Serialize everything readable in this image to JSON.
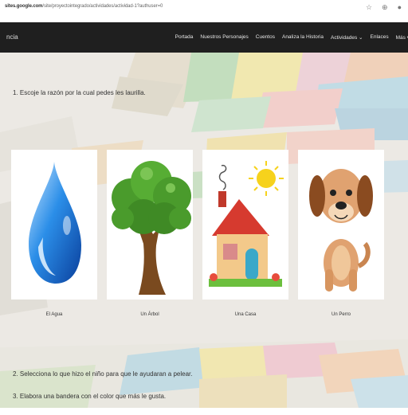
{
  "browser": {
    "url_host": "sites.google.com",
    "url_rest": "/site/proyectointegrado/actividades/actividad-1?authuser=0",
    "icons": [
      "star-icon",
      "extension-icon",
      "profile-icon"
    ]
  },
  "nav": {
    "brand": "ncia",
    "links": [
      "Portada",
      "Nuestros Personajes",
      "Cuentos",
      "Analiza la Historia",
      "Actividades ⌄",
      "Enlaces",
      "Más ▾"
    ]
  },
  "questions": {
    "q1": "1. Escoje la razón por la cual pedes les laurilla.",
    "q2": "2. Selecciona lo que hizo el niño para que le ayudaran a pelear.",
    "q3": "3. Elabora una bandera con el color que más le gusta."
  },
  "cards": [
    {
      "caption": "El Agua",
      "icon": "water-drop-icon"
    },
    {
      "caption": "Un Árbol",
      "icon": "tree-icon"
    },
    {
      "caption": "Una Casa",
      "icon": "house-icon"
    },
    {
      "caption": "Un Perro",
      "icon": "dog-icon"
    }
  ]
}
